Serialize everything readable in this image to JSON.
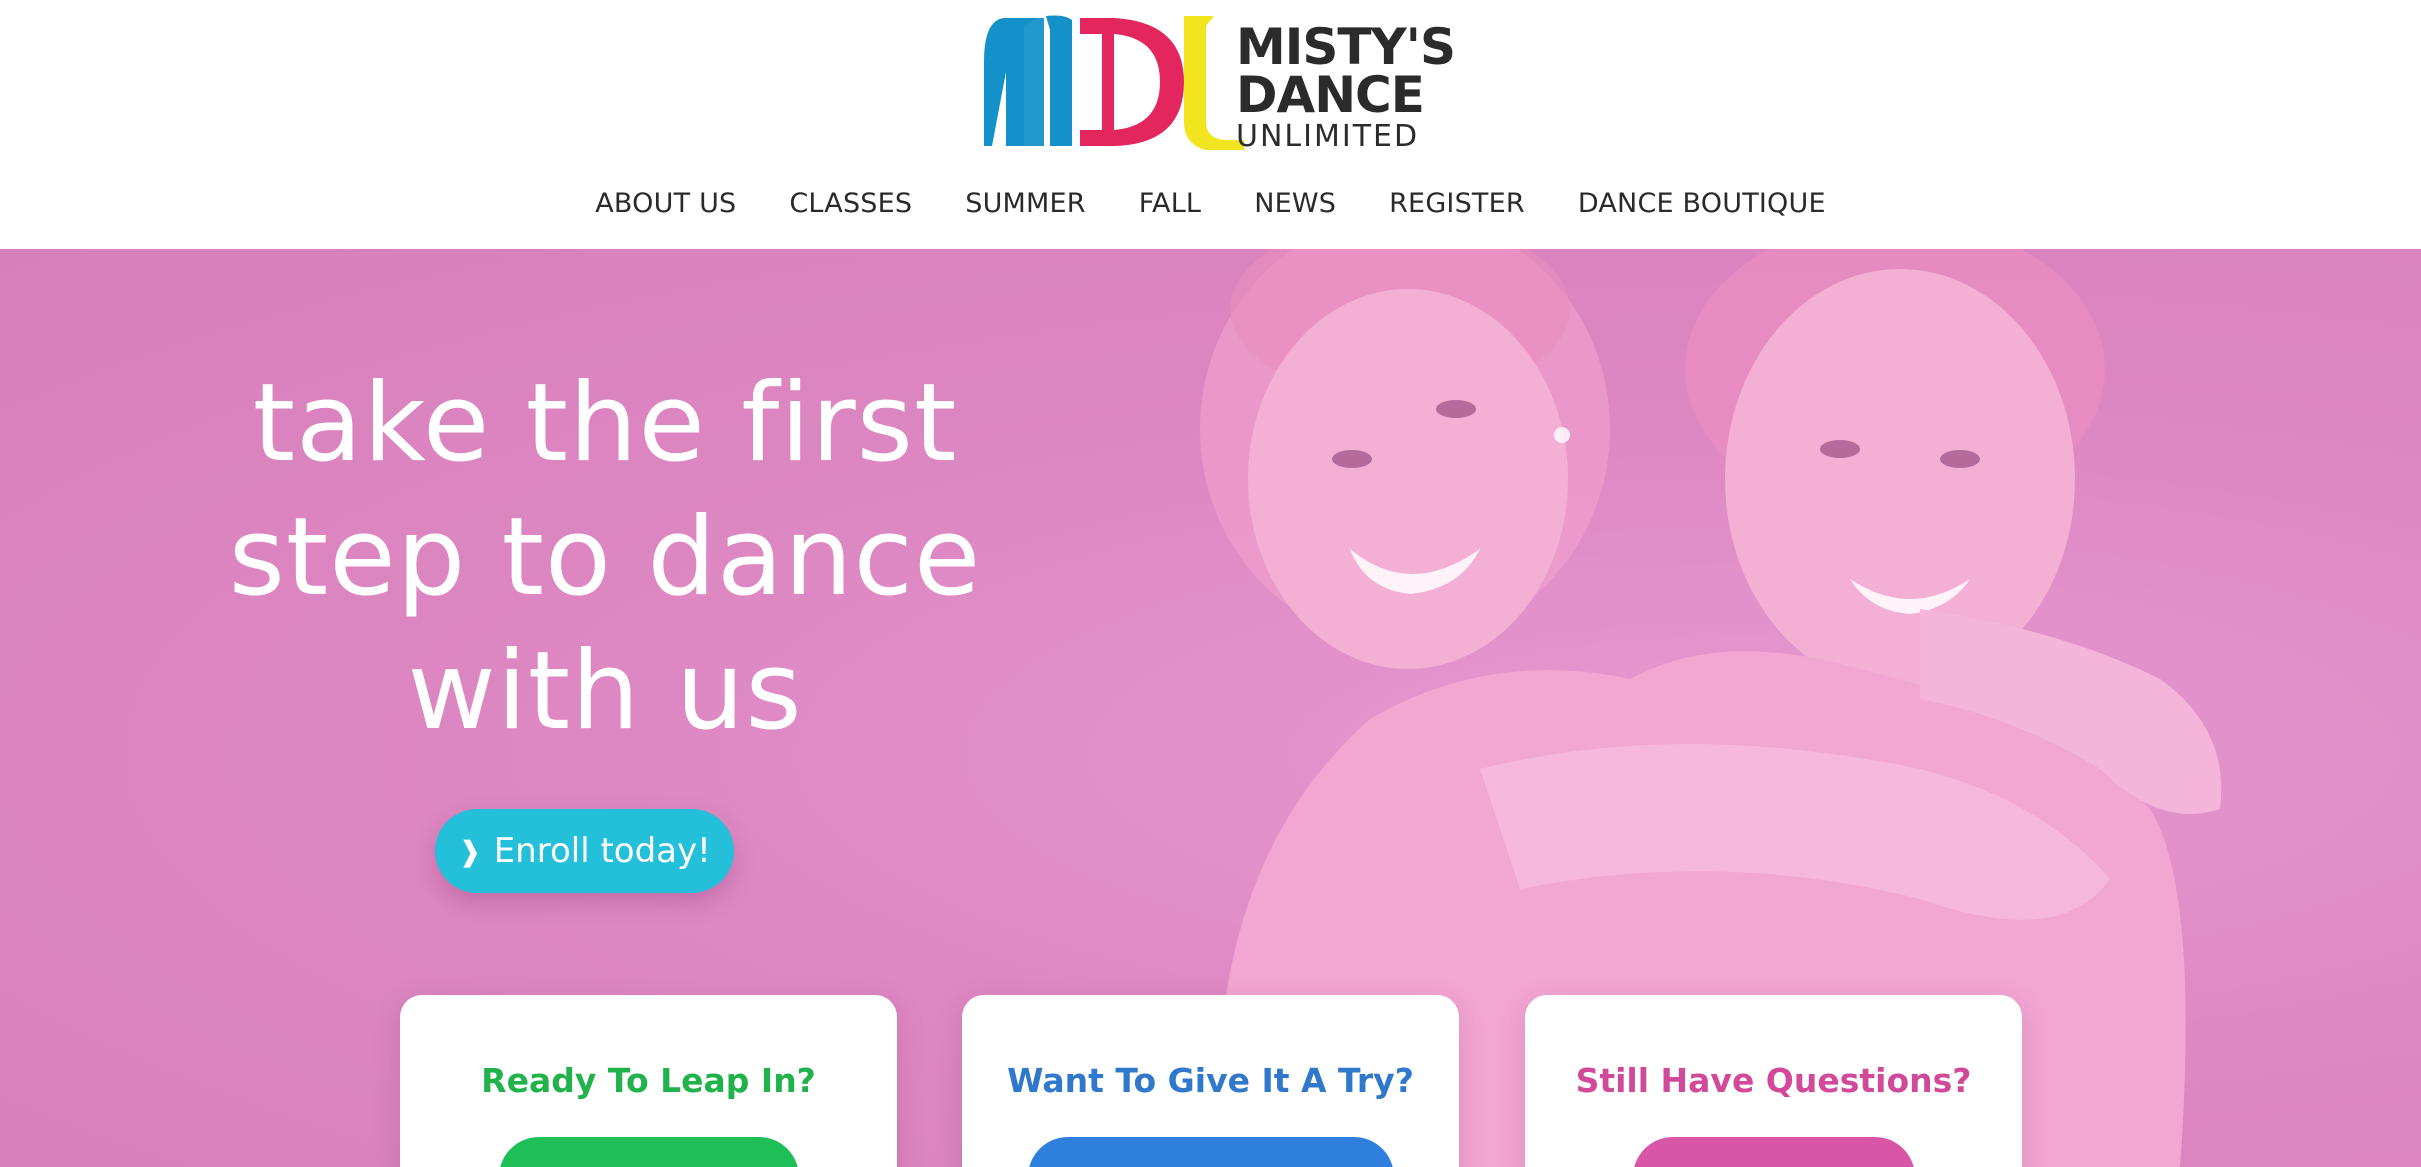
{
  "brand": {
    "name_line1": "MISTY'S",
    "name_line2": "DANCE",
    "name_line3": "UNLIMITED",
    "logo_colors": {
      "m": "#1591c9",
      "d": "#e3265e",
      "u": "#f1e51f"
    }
  },
  "nav": {
    "items": [
      {
        "label": "ABOUT US"
      },
      {
        "label": "CLASSES"
      },
      {
        "label": "SUMMER"
      },
      {
        "label": "FALL"
      },
      {
        "label": "NEWS"
      },
      {
        "label": "REGISTER"
      },
      {
        "label": "DANCE BOUTIQUE"
      }
    ]
  },
  "hero": {
    "headline_line1": "take the first",
    "headline_line2": "step to dance",
    "headline_line3": "with us",
    "cta_icon": "chevron-right-icon",
    "cta_label": "Enroll today!",
    "overlay_color": "#df8ac4"
  },
  "cards": [
    {
      "title": "Ready To Leap In?",
      "accent": "#1fbf57"
    },
    {
      "title": "Want To Give It A Try?",
      "accent": "#2f7fdc"
    },
    {
      "title": "Still Have Questions?",
      "accent": "#d955a6"
    }
  ],
  "colors": {
    "cta": "#24bfd8"
  }
}
